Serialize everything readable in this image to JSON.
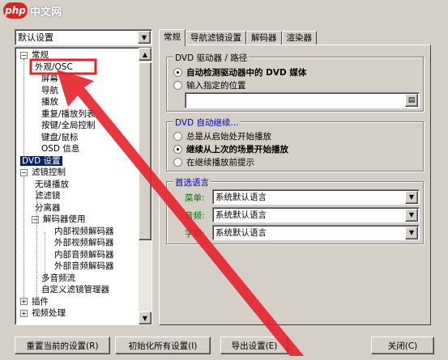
{
  "watermark": {
    "badge": "php",
    "text": "中文网"
  },
  "preset": {
    "value": "默认设置"
  },
  "tree": {
    "items": [
      {
        "label": "常规",
        "expander": "−"
      },
      {
        "label": "外观/OSC"
      },
      {
        "label": "屏幕"
      },
      {
        "label": "导航"
      },
      {
        "label": "播放"
      },
      {
        "label": "重复/播放列表"
      },
      {
        "label": "按键/全局控制"
      },
      {
        "label": "键盘/鼠标"
      },
      {
        "label": "OSD 信息"
      },
      {
        "label": "DVD 设置"
      },
      {
        "label": "滤镜控制",
        "expander": "−"
      },
      {
        "label": "无缝播放"
      },
      {
        "label": "滤滤镜"
      },
      {
        "label": "分离器"
      },
      {
        "label": "解码器使用",
        "expander": "−"
      },
      {
        "label": "内部视频解码器"
      },
      {
        "label": "外部视频解码器"
      },
      {
        "label": "内部音频解码器"
      },
      {
        "label": "外部音频解码器"
      },
      {
        "label": "多音频流"
      },
      {
        "label": "自定义滤镜管理器"
      },
      {
        "label": "插件",
        "expander": "+"
      },
      {
        "label": "视频处理",
        "expander": "+"
      }
    ]
  },
  "tabs": [
    "常规",
    "导航滤镜设置",
    "解码器",
    "渲染器"
  ],
  "dvd_drive": {
    "title": "DVD 驱动器 / 路径",
    "opt_auto": "自动检测驱动器中的 DVD 媒体",
    "opt_manual": "输入指定的位置",
    "path_value": ""
  },
  "dvd_resume": {
    "title": "DVD 自动继续...",
    "opt1": "总是从启始处开始播放",
    "opt2": "继续从上次的场景开始播放",
    "opt3": "在继续播放前提示"
  },
  "language": {
    "title": "首选语言",
    "menu_label": "菜单:",
    "menu_value": "系统默认语言",
    "audio_label": "音频:",
    "audio_value": "系统默认语言",
    "subtitle_label": "字幕:",
    "subtitle_value": "系统默认语言"
  },
  "buttons": {
    "reset": "重置当前的设置(R)",
    "init_all": "初始化所有设置(I)",
    "export": "导出设置(E)",
    "close": "关闭(C)"
  },
  "colors": {
    "annotation": "#e8202a",
    "selection": "#0a246a",
    "group_title": "#0000c0",
    "lang_label": "#007000"
  }
}
